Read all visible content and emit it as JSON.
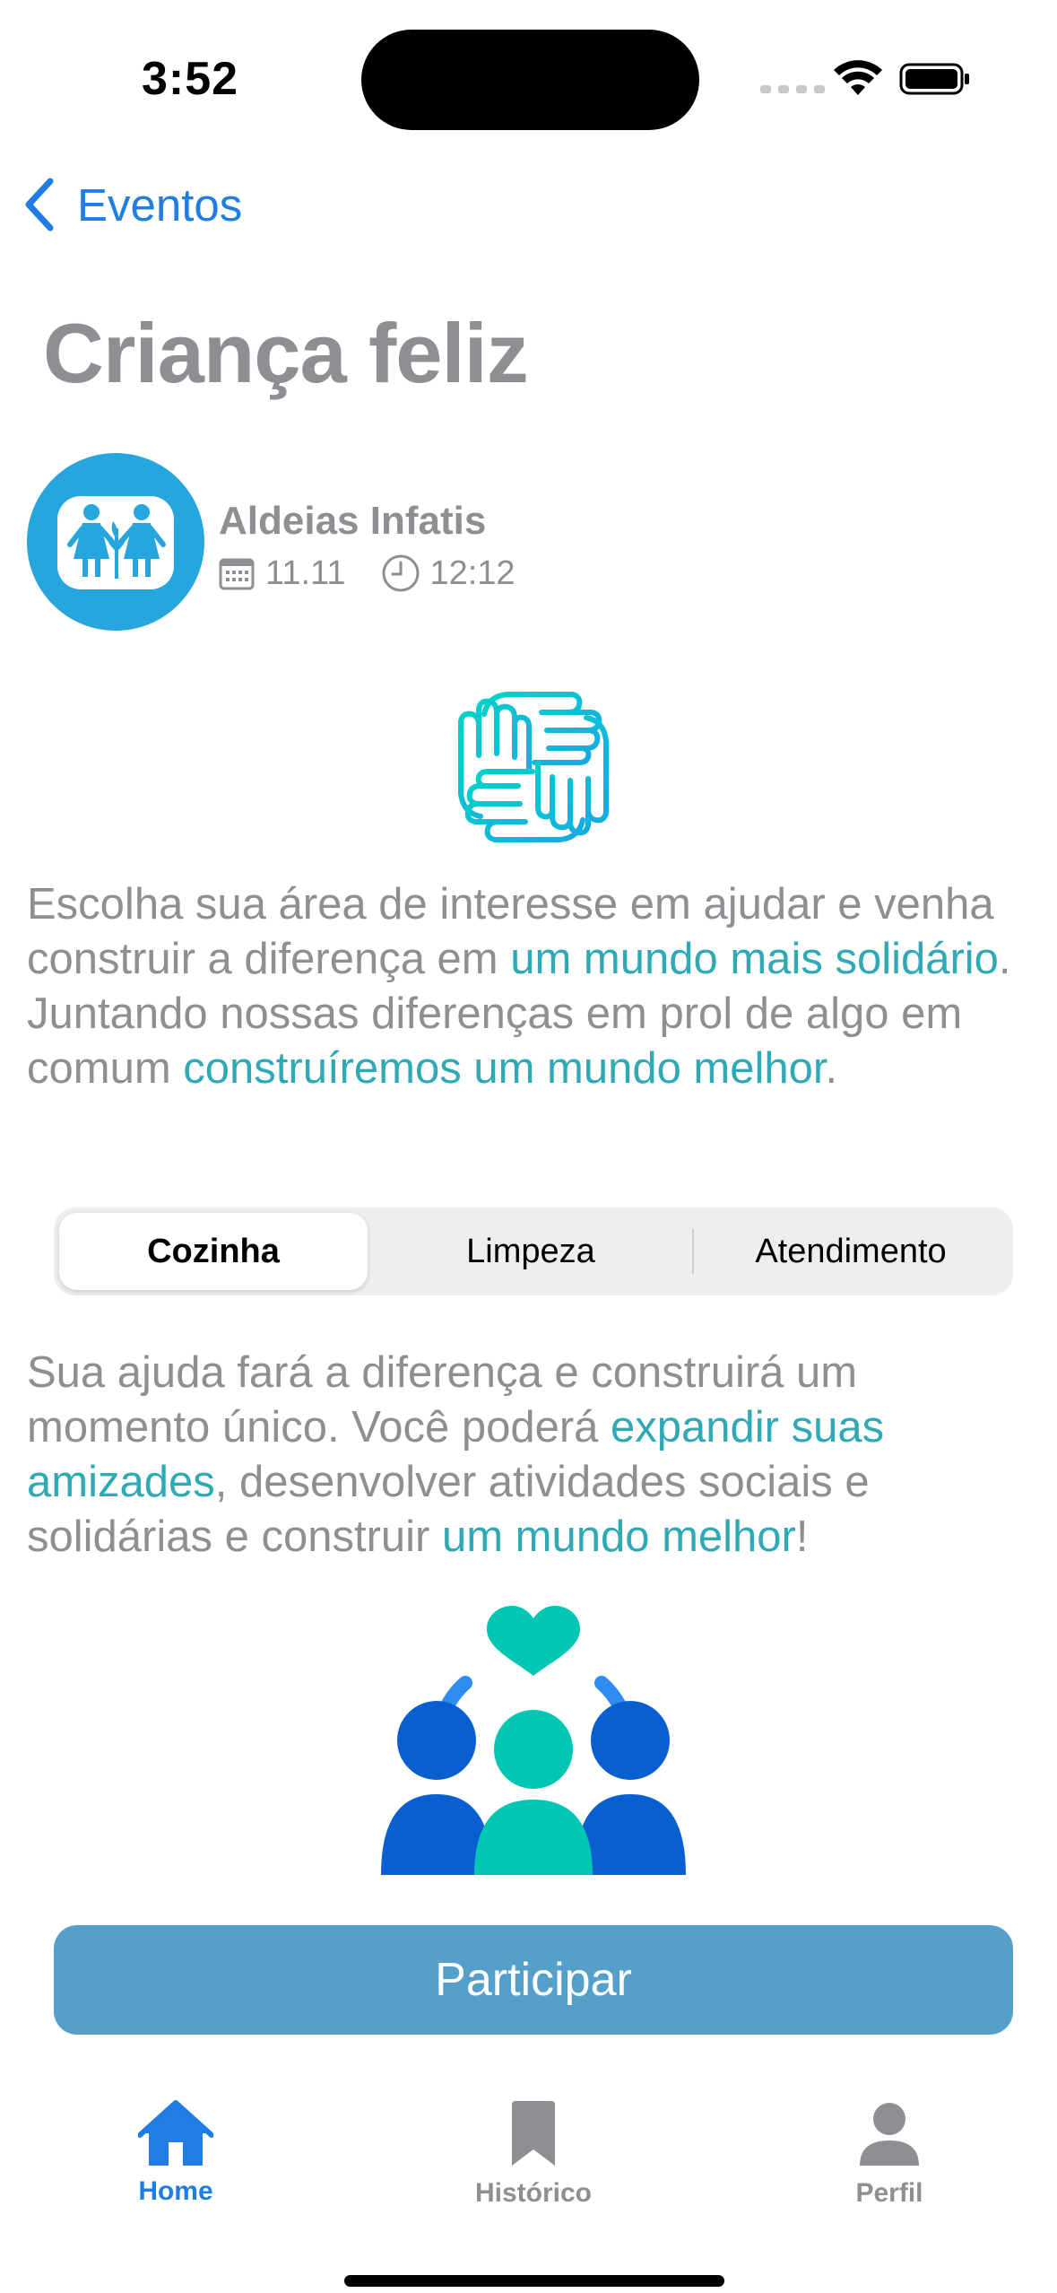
{
  "status_bar": {
    "time": "3:52",
    "icons": [
      "signal-icon",
      "wifi-icon",
      "battery-icon"
    ]
  },
  "nav": {
    "back_label": "Eventos",
    "back_icon": "chevron-left-icon"
  },
  "title": "Criança feliz",
  "organizer": {
    "name": "Aldeias Infatis",
    "date": "11.11",
    "time": "12:12",
    "date_icon": "calendar-icon",
    "time_icon": "clock-icon"
  },
  "intro": {
    "t1": "Escolha sua área de interesse em ajudar e venha construir a diferença em ",
    "h1": "um mundo mais solidário",
    "t2": ". Juntando nossas diferenças em prol de algo em comum ",
    "h2": "construíremos um mundo melhor",
    "t3": "."
  },
  "segments": {
    "options": [
      "Cozinha",
      "Limpeza",
      "Atendimento"
    ],
    "selected": "Cozinha"
  },
  "description": {
    "t1": "Sua ajuda fará a diferença e construirá um momento único. Você poderá ",
    "h1": "expandir suas amizades",
    "t2": ", desenvolver atividades sociais e solidárias e construir ",
    "h2": "um mundo melhor",
    "t3": "!"
  },
  "participate_label": "Participar",
  "tabs": [
    {
      "label": "Home",
      "icon": "house-icon",
      "active": true
    },
    {
      "label": "Histórico",
      "icon": "bookmark-icon",
      "active": false
    },
    {
      "label": "Perfil",
      "icon": "person-icon",
      "active": false
    }
  ],
  "colors": {
    "accent": "#1f7de4",
    "highlight": "#2fa9b5",
    "muted_text": "#8e8e93",
    "button": "#559fcb",
    "logo_bg": "#27a5dd",
    "teal": "#00c6b3",
    "blue_dark": "#0a5fd0"
  }
}
